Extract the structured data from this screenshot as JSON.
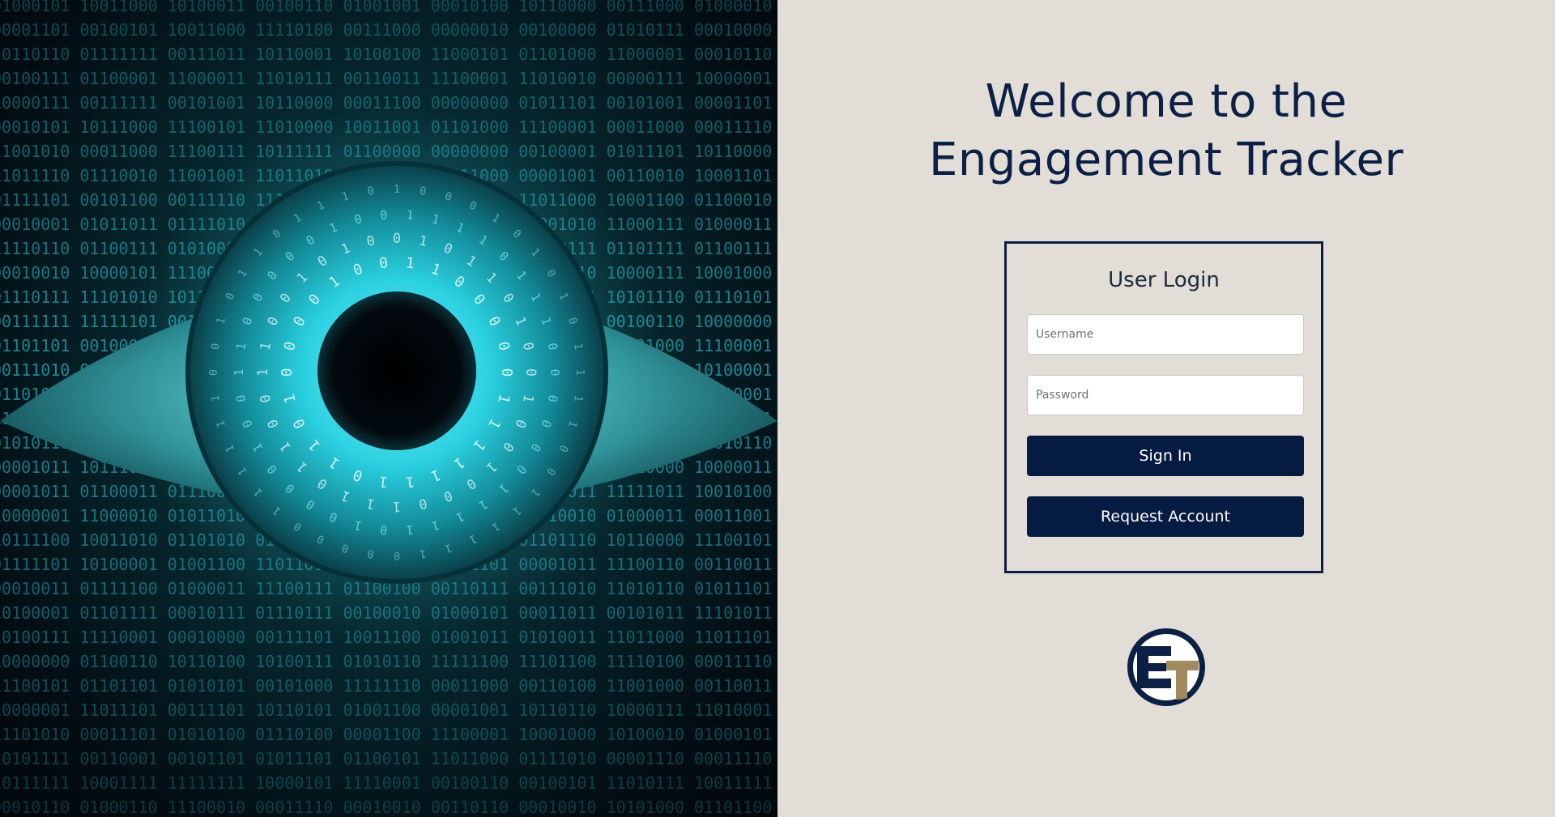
{
  "hero": {
    "image_desc_icon": "binary-eye-image",
    "colors": {
      "cyan": "#3ef0ff",
      "teal": "#1a8a94",
      "dark": "#020d13"
    }
  },
  "welcome": {
    "line1": "Welcome to the",
    "line2": "Engagement Tracker"
  },
  "login": {
    "heading": "User Login",
    "username_placeholder": "Username",
    "password_placeholder": "Password",
    "signin_label": "Sign In",
    "request_label": "Request Account"
  },
  "logo": {
    "icon": "et-logo",
    "colors": {
      "navy": "#0c1f45",
      "gold": "#a08a5e"
    }
  },
  "theme": {
    "panel_bg": "#e2ded7",
    "title_color": "#0c1f45",
    "button_bg": "#051b42"
  }
}
